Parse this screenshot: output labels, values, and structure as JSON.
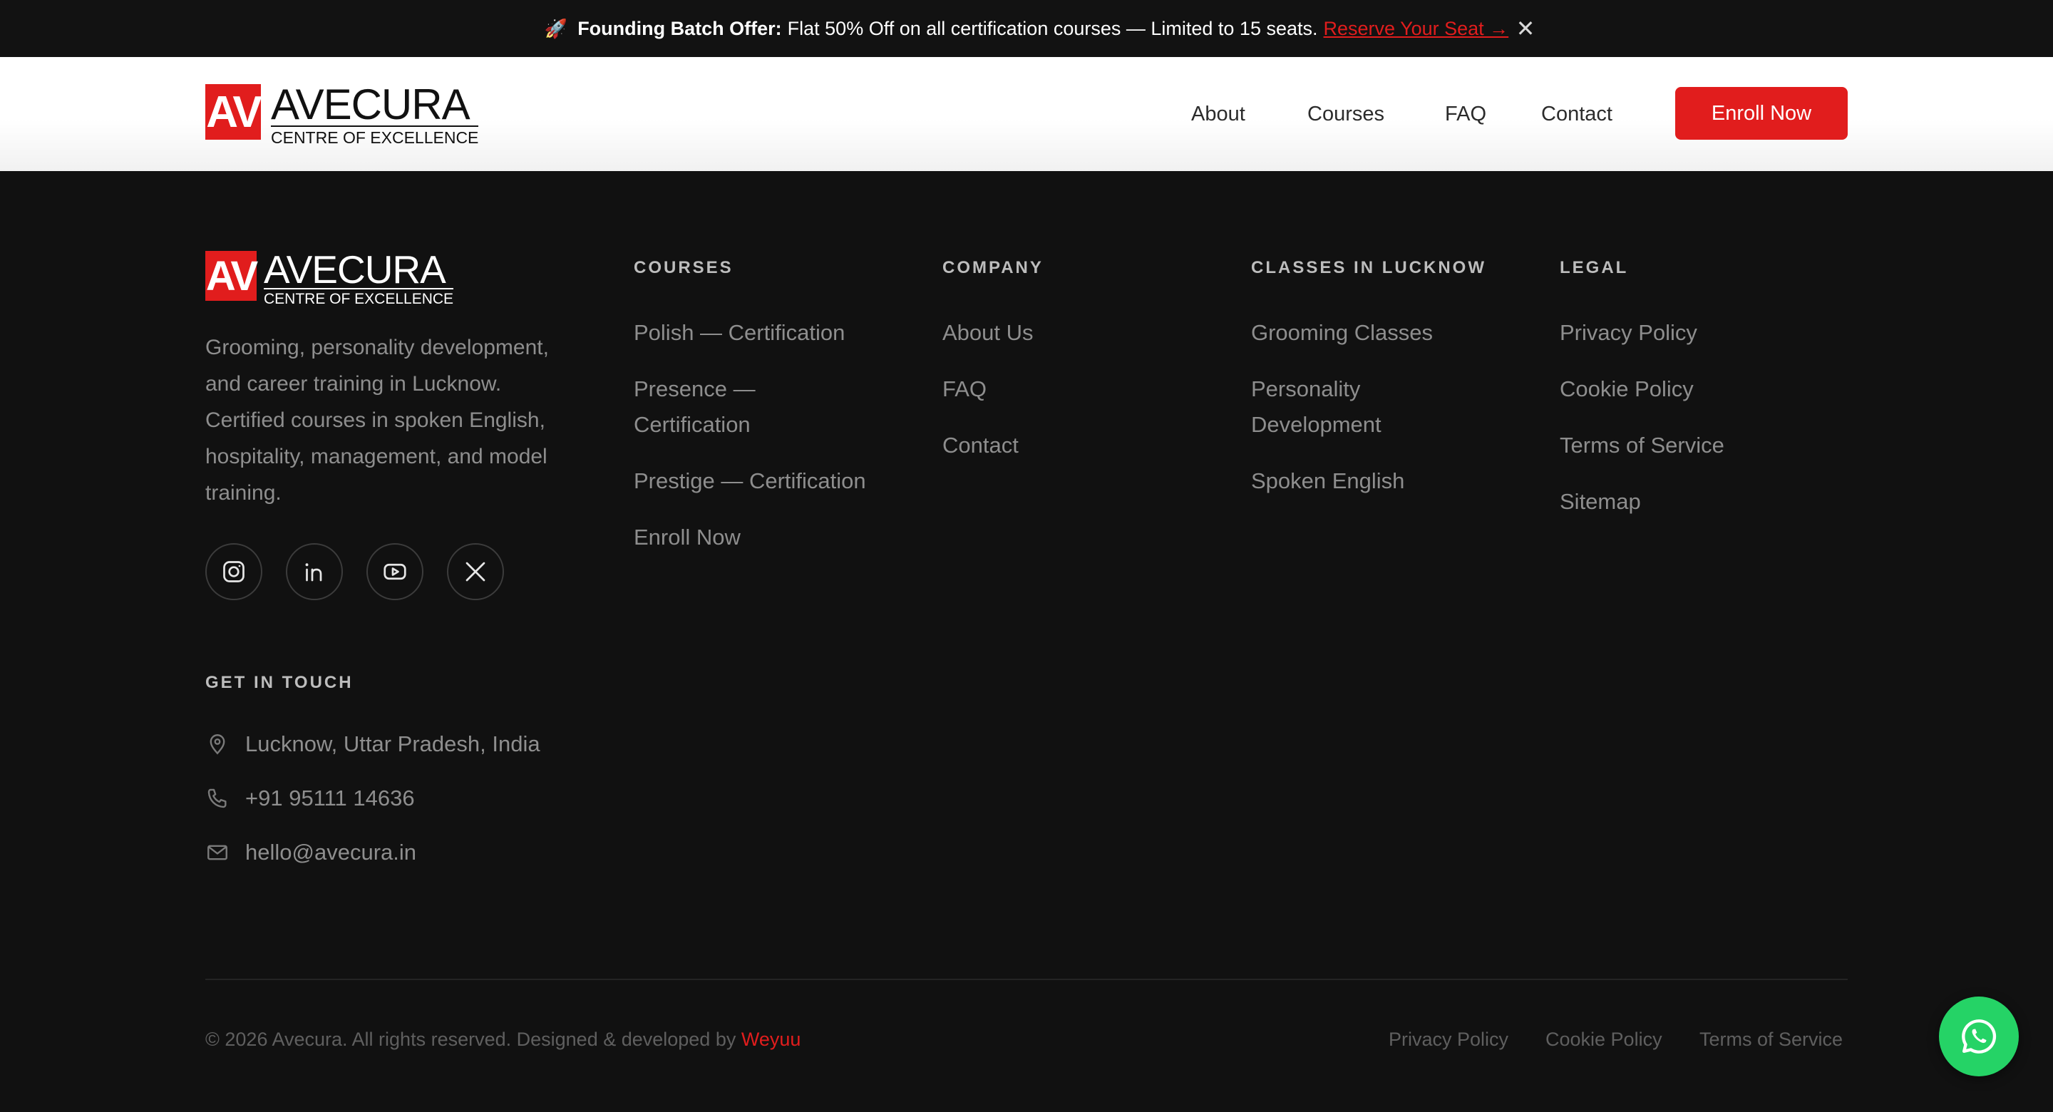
{
  "announcement": {
    "emoji": "🚀",
    "bold_text": "Founding Batch Offer:",
    "text": "Flat 50% Off on all certification courses — Limited to 15 seats.",
    "link": "Reserve Your Seat →",
    "close": "✕"
  },
  "brand": {
    "mark": "AV",
    "name": "AVECURA",
    "tagline": "CENTRE OF EXCELLENCE",
    "accent_color": "#e11d1d"
  },
  "nav": {
    "items": [
      "About",
      "Courses",
      "FAQ",
      "Contact"
    ],
    "cta": "Enroll Now"
  },
  "footer": {
    "description": "Grooming, personality development, and career training in Lucknow. Certified courses in spoken English, hospitality, management, and model training.",
    "socials": [
      "instagram-icon",
      "linkedin-icon",
      "youtube-icon",
      "x-icon"
    ],
    "columns": [
      {
        "heading": "COURSES",
        "links": [
          "Polish — Certification",
          "Presence — Certification",
          "Prestige — Certification",
          "Enroll Now"
        ]
      },
      {
        "heading": "COMPANY",
        "links": [
          "About Us",
          "FAQ",
          "Contact"
        ]
      },
      {
        "heading": "CLASSES IN LUCKNOW",
        "links": [
          "Grooming Classes",
          "Personality Development",
          "Spoken English"
        ]
      },
      {
        "heading": "LEGAL",
        "links": [
          "Privacy Policy",
          "Cookie Policy",
          "Terms of Service",
          "Sitemap"
        ]
      }
    ],
    "contact": {
      "heading": "GET IN TOUCH",
      "address": "Lucknow, Uttar Pradesh, India",
      "phone": "+91 95111 14636",
      "email": "hello@avecura.in"
    },
    "copyright_prefix": "© 2026 Avecura. All rights reserved. Designed & developed by",
    "developer": "Weyuu",
    "bottom_links": [
      "Privacy Policy",
      "Cookie Policy",
      "Terms of Service"
    ]
  },
  "whatsapp": {
    "icon": "whatsapp-icon",
    "color": "#25d366"
  }
}
